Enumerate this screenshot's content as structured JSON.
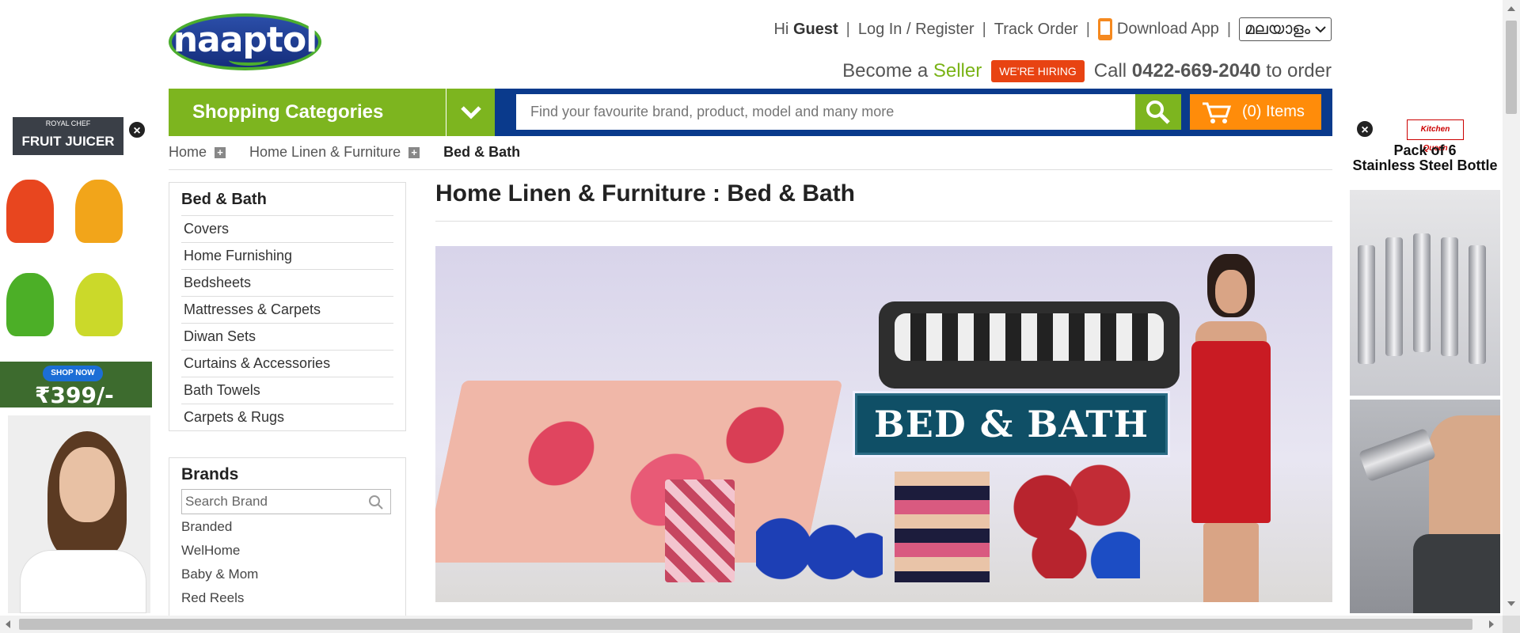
{
  "header": {
    "logo_text": "naaptol",
    "greeting_prefix": "Hi",
    "greeting_user": "Guest",
    "login": "Log In / Register",
    "track": "Track Order",
    "download": "Download App",
    "language": "മലയാളം",
    "become": "Become a",
    "seller": "Seller",
    "hiring": "WE'RE HIRING",
    "call": "Call",
    "phone": "0422-669-2040",
    "call_suffix": "to order"
  },
  "navbar": {
    "categories": "Shopping Categories",
    "search_placeholder": "Find your favourite brand, product, model and many more",
    "cart": "(0) Items"
  },
  "breadcrumb": [
    "Home",
    "Home Linen & Furniture",
    "Bed & Bath"
  ],
  "sidebar": {
    "title": "Bed & Bath",
    "items": [
      "Covers",
      "Home Furnishing",
      "Bedsheets",
      "Mattresses & Carpets",
      "Diwan Sets",
      "Curtains & Accessories",
      "Bath Towels",
      "Carpets & Rugs"
    ]
  },
  "brands": {
    "title": "Brands",
    "search_placeholder": "Search Brand",
    "items": [
      "Branded",
      "WelHome",
      "Baby & Mom",
      "Red Reels"
    ]
  },
  "main": {
    "title": "Home Linen & Furniture : Bed & Bath",
    "banner_text": "BED & BATH"
  },
  "ad_left": {
    "brand_small": "ROYAL CHEF",
    "brand": "FRUIT JUICER",
    "shop": "SHOP NOW",
    "price": "₹399/-"
  },
  "ad_right": {
    "brand": "Kitchen Queen",
    "line1": "Pack of 6",
    "line2": "Stainless Steel Bottle"
  },
  "colors": {
    "green": "#7db51f",
    "navy": "#0a3a8c",
    "orange": "#ff8c0a",
    "hiring_red": "#e84312"
  }
}
